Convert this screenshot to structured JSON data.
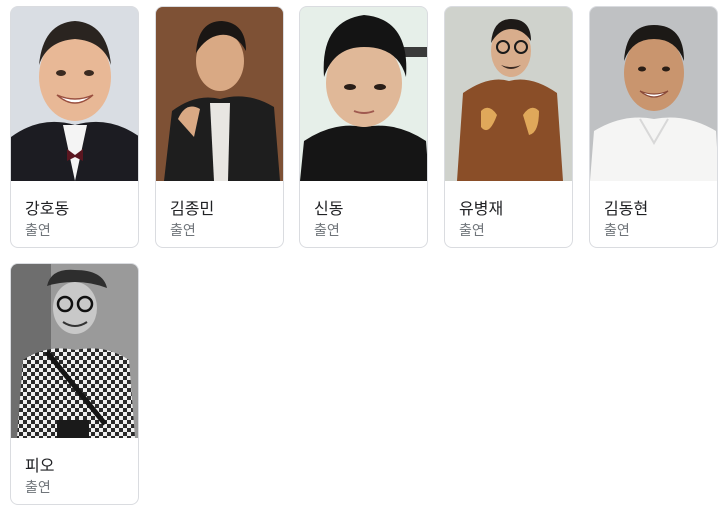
{
  "cast": [
    {
      "name": "강호동",
      "role": "출연"
    },
    {
      "name": "김종민",
      "role": "출연"
    },
    {
      "name": "신동",
      "role": "출연"
    },
    {
      "name": "유병재",
      "role": "출연"
    },
    {
      "name": "김동현",
      "role": "출연"
    },
    {
      "name": "피오",
      "role": "출연"
    }
  ]
}
